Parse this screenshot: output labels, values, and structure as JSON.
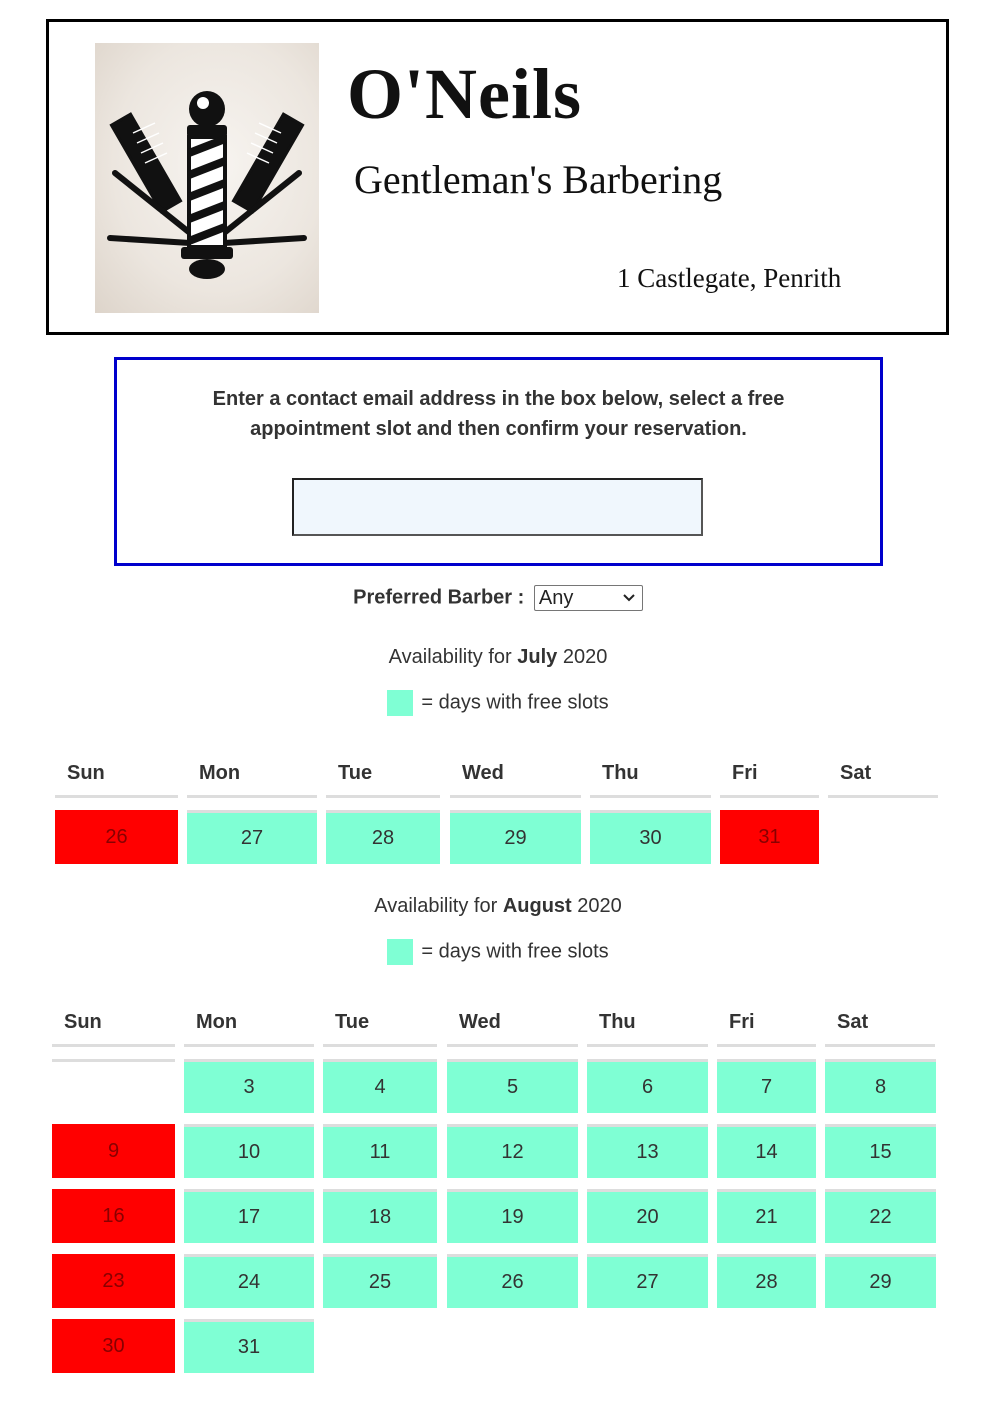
{
  "header": {
    "brand": "O'Neils",
    "tagline": "Gentleman's Barbering",
    "address": "1 Castlegate, Penrith"
  },
  "instructions": {
    "text": "Enter a contact email address in the box below, select a free appointment slot and then confirm your reservation.",
    "email_value": "",
    "email_placeholder": ""
  },
  "barber": {
    "label": "Preferred Barber :",
    "selected": "Any"
  },
  "colors": {
    "free": "#7fffd4",
    "closed": "#ff0000",
    "instruction_border": "#0000cc"
  },
  "weekdays": [
    "Sun",
    "Mon",
    "Tue",
    "Wed",
    "Thu",
    "Fri",
    "Sat"
  ],
  "legend_text": "= days with free slots",
  "months": [
    {
      "prefix": "Availability for",
      "month": "July",
      "year": "2020",
      "weeks": [
        [
          {
            "day": "26",
            "status": "closed"
          },
          {
            "day": "27",
            "status": "free"
          },
          {
            "day": "28",
            "status": "free"
          },
          {
            "day": "29",
            "status": "free"
          },
          {
            "day": "30",
            "status": "free"
          },
          {
            "day": "31",
            "status": "closed"
          },
          null
        ]
      ]
    },
    {
      "prefix": "Availability for",
      "month": "August",
      "year": "2020",
      "weeks": [
        [
          {
            "day": "",
            "status": "blank"
          },
          {
            "day": "3",
            "status": "free"
          },
          {
            "day": "4",
            "status": "free"
          },
          {
            "day": "5",
            "status": "free"
          },
          {
            "day": "6",
            "status": "free"
          },
          {
            "day": "7",
            "status": "free"
          },
          {
            "day": "8",
            "status": "free"
          }
        ],
        [
          {
            "day": "9",
            "status": "closed"
          },
          {
            "day": "10",
            "status": "free"
          },
          {
            "day": "11",
            "status": "free"
          },
          {
            "day": "12",
            "status": "free"
          },
          {
            "day": "13",
            "status": "free"
          },
          {
            "day": "14",
            "status": "free"
          },
          {
            "day": "15",
            "status": "free"
          }
        ],
        [
          {
            "day": "16",
            "status": "closed"
          },
          {
            "day": "17",
            "status": "free"
          },
          {
            "day": "18",
            "status": "free"
          },
          {
            "day": "19",
            "status": "free"
          },
          {
            "day": "20",
            "status": "free"
          },
          {
            "day": "21",
            "status": "free"
          },
          {
            "day": "22",
            "status": "free"
          }
        ],
        [
          {
            "day": "23",
            "status": "closed"
          },
          {
            "day": "24",
            "status": "free"
          },
          {
            "day": "25",
            "status": "free"
          },
          {
            "day": "26",
            "status": "free"
          },
          {
            "day": "27",
            "status": "free"
          },
          {
            "day": "28",
            "status": "free"
          },
          {
            "day": "29",
            "status": "free"
          }
        ],
        [
          {
            "day": "30",
            "status": "closed"
          },
          {
            "day": "31",
            "status": "free"
          },
          null,
          null,
          null,
          null,
          null
        ]
      ]
    }
  ]
}
